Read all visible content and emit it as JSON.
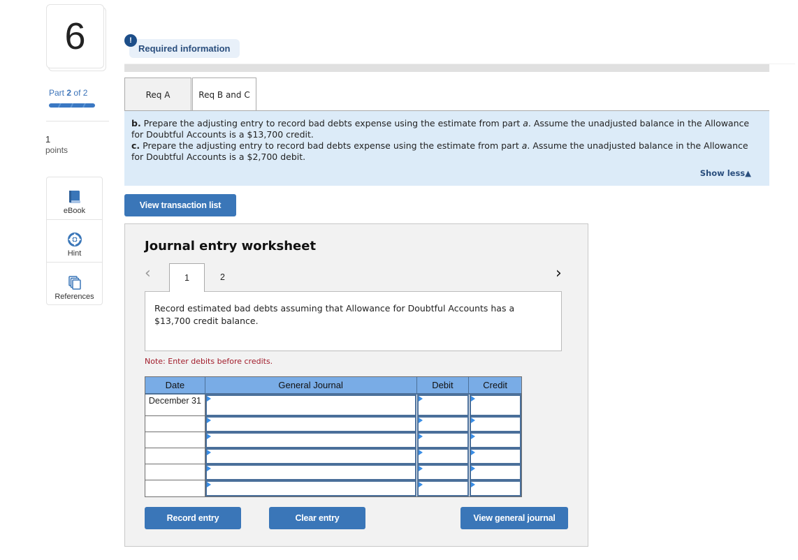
{
  "question": {
    "number": "6",
    "part_label": "Part",
    "part_current": "2",
    "part_of": "of 2",
    "part_progress_fraction": 1.0,
    "points_value": "1",
    "points_label": "points"
  },
  "tools": [
    {
      "label": "eBook",
      "icon": "book-icon"
    },
    {
      "label": "Hint",
      "icon": "lifebuoy-icon"
    },
    {
      "label": "References",
      "icon": "documents-icon"
    }
  ],
  "required_info": {
    "badge": "!",
    "label": "Required information"
  },
  "req_tabs": [
    {
      "label": "Req A",
      "active": false
    },
    {
      "label": "Req B and C",
      "active": true
    }
  ],
  "instructions": {
    "b_prefix": "b.",
    "b_text_1": " Prepare the adjusting entry to record bad debts expense using the estimate from part ",
    "b_part": "a",
    "b_text_2": ". Assume the unadjusted balance in the Allowance for Doubtful Accounts is a $13,700 credit.",
    "c_prefix": "c.",
    "c_text_1": " Prepare the adjusting entry to record bad debts expense using the estimate from part ",
    "c_part": "a",
    "c_text_2": ". Assume the unadjusted balance in the Allowance for Doubtful Accounts is a $2,700 debit.",
    "show_less": "Show less▲"
  },
  "buttons": {
    "view_transaction_list": "View transaction list",
    "record_entry": "Record entry",
    "clear_entry": "Clear entry",
    "view_general_journal": "View general journal"
  },
  "worksheet": {
    "title": "Journal entry worksheet",
    "prev_icon": "‹",
    "next_icon": "›",
    "tabs": [
      "1",
      "2"
    ],
    "active_tab": "1",
    "description": "Record estimated bad debts assuming that Allowance for Doubtful Accounts has a $13,700 credit balance.",
    "note": "Note: Enter debits before credits."
  },
  "journal": {
    "headers": {
      "date": "Date",
      "account": "General Journal",
      "debit": "Debit",
      "credit": "Credit"
    },
    "rows": [
      {
        "date": "December 31",
        "account": "",
        "debit": "",
        "credit": ""
      },
      {
        "date": "",
        "account": "",
        "debit": "",
        "credit": ""
      },
      {
        "date": "",
        "account": "",
        "debit": "",
        "credit": ""
      },
      {
        "date": "",
        "account": "",
        "debit": "",
        "credit": ""
      },
      {
        "date": "",
        "account": "",
        "debit": "",
        "credit": ""
      },
      {
        "date": "",
        "account": "",
        "debit": "",
        "credit": ""
      }
    ]
  },
  "colors": {
    "accent_button": "#3a76b8",
    "table_header": "#79ace6",
    "instruction_bg": "#dcebf8",
    "note_text": "#a11b2a"
  }
}
